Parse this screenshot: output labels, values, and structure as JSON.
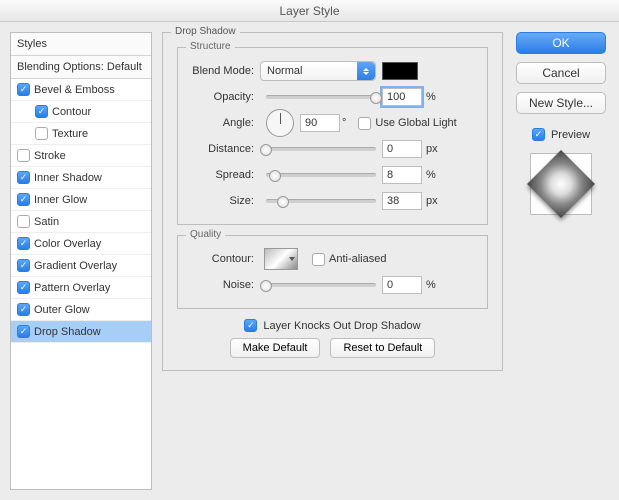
{
  "window": {
    "title": "Layer Style"
  },
  "sidebar": {
    "header_styles": "Styles",
    "header_blending": "Blending Options: Default",
    "items": [
      {
        "label": "Bevel & Emboss",
        "checked": true,
        "indent": false
      },
      {
        "label": "Contour",
        "checked": true,
        "indent": true
      },
      {
        "label": "Texture",
        "checked": false,
        "indent": true
      },
      {
        "label": "Stroke",
        "checked": false,
        "indent": false
      },
      {
        "label": "Inner Shadow",
        "checked": true,
        "indent": false
      },
      {
        "label": "Inner Glow",
        "checked": true,
        "indent": false
      },
      {
        "label": "Satin",
        "checked": false,
        "indent": false
      },
      {
        "label": "Color Overlay",
        "checked": true,
        "indent": false
      },
      {
        "label": "Gradient Overlay",
        "checked": true,
        "indent": false
      },
      {
        "label": "Pattern Overlay",
        "checked": true,
        "indent": false
      },
      {
        "label": "Outer Glow",
        "checked": true,
        "indent": false
      },
      {
        "label": "Drop Shadow",
        "checked": true,
        "indent": false,
        "selected": true
      }
    ]
  },
  "panel": {
    "group_title": "Drop Shadow",
    "structure": {
      "title": "Structure",
      "blend_mode_label": "Blend Mode:",
      "blend_mode_value": "Normal",
      "color": "#000000",
      "opacity_label": "Opacity:",
      "opacity_value": "100",
      "opacity_unit": "%",
      "angle_label": "Angle:",
      "angle_value": "90",
      "angle_unit": "°",
      "use_global_label": "Use Global Light",
      "use_global_checked": false,
      "distance_label": "Distance:",
      "distance_value": "0",
      "distance_unit": "px",
      "spread_label": "Spread:",
      "spread_value": "8",
      "spread_unit": "%",
      "size_label": "Size:",
      "size_value": "38",
      "size_unit": "px"
    },
    "quality": {
      "title": "Quality",
      "contour_label": "Contour:",
      "anti_aliased_label": "Anti-aliased",
      "anti_aliased_checked": false,
      "noise_label": "Noise:",
      "noise_value": "0",
      "noise_unit": "%"
    },
    "knockout_label": "Layer Knocks Out Drop Shadow",
    "knockout_checked": true,
    "make_default_label": "Make Default",
    "reset_default_label": "Reset to Default"
  },
  "right": {
    "ok": "OK",
    "cancel": "Cancel",
    "new_style": "New Style...",
    "preview_label": "Preview",
    "preview_checked": true
  }
}
